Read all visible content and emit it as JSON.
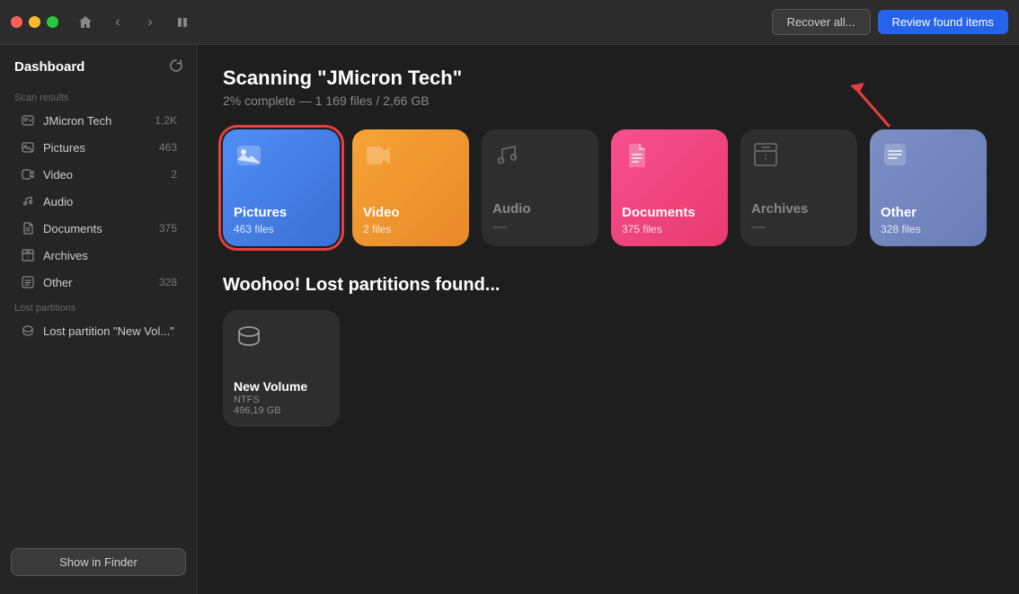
{
  "titlebar": {
    "home_icon": "⌂",
    "back_icon": "‹",
    "forward_icon": "›",
    "pause_icon": "⏸",
    "recover_label": "Recover all...",
    "review_label": "Review found items"
  },
  "sidebar": {
    "title": "Dashboard",
    "dashboard_icon": "⊞",
    "spin_icon": "↻",
    "scan_results_label": "Scan results",
    "items": [
      {
        "id": "jmicron",
        "icon": "💾",
        "label": "JMicron Tech",
        "count": "1,2K"
      },
      {
        "id": "pictures",
        "icon": "🖼",
        "label": "Pictures",
        "count": "463"
      },
      {
        "id": "video",
        "icon": "🎬",
        "label": "Video",
        "count": "2"
      },
      {
        "id": "audio",
        "icon": "♪",
        "label": "Audio",
        "count": ""
      },
      {
        "id": "documents",
        "icon": "📄",
        "label": "Documents",
        "count": "375"
      },
      {
        "id": "archives",
        "icon": "🗜",
        "label": "Archives",
        "count": ""
      },
      {
        "id": "other",
        "icon": "📁",
        "label": "Other",
        "count": "328"
      }
    ],
    "lost_partitions_label": "Lost partitions",
    "lost_partition": {
      "label": "Lost partition \"New Vol...\""
    },
    "show_in_finder": "Show in Finder"
  },
  "content": {
    "scan_title": "Scanning \"JMicron Tech\"",
    "scan_subtitle": "2% complete — 1 169 files / 2,66 GB",
    "cards": [
      {
        "id": "pictures",
        "type": "colored",
        "theme": "blue",
        "icon": "🖼",
        "name": "Pictures",
        "count": "463 files",
        "selected": true
      },
      {
        "id": "video",
        "type": "colored",
        "theme": "orange",
        "icon": "🎬",
        "name": "Video",
        "count": "2 files",
        "selected": false
      },
      {
        "id": "audio",
        "type": "gray",
        "theme": "gray",
        "icon": "♪",
        "name": "Audio",
        "count": "—",
        "selected": false
      },
      {
        "id": "documents",
        "type": "colored",
        "theme": "pink",
        "icon": "📄",
        "name": "Documents",
        "count": "375 files",
        "selected": false
      },
      {
        "id": "archives",
        "type": "gray",
        "theme": "gray",
        "icon": "🗜",
        "name": "Archives",
        "count": "—",
        "selected": false
      },
      {
        "id": "other",
        "type": "colored",
        "theme": "purple",
        "icon": "📝",
        "name": "Other",
        "count": "328 files",
        "selected": false
      }
    ],
    "lost_partitions_title": "Woohoo! Lost partitions found...",
    "partition": {
      "icon": "💿",
      "name": "New Volume",
      "fs": "NTFS",
      "size": "496,19 GB"
    }
  }
}
